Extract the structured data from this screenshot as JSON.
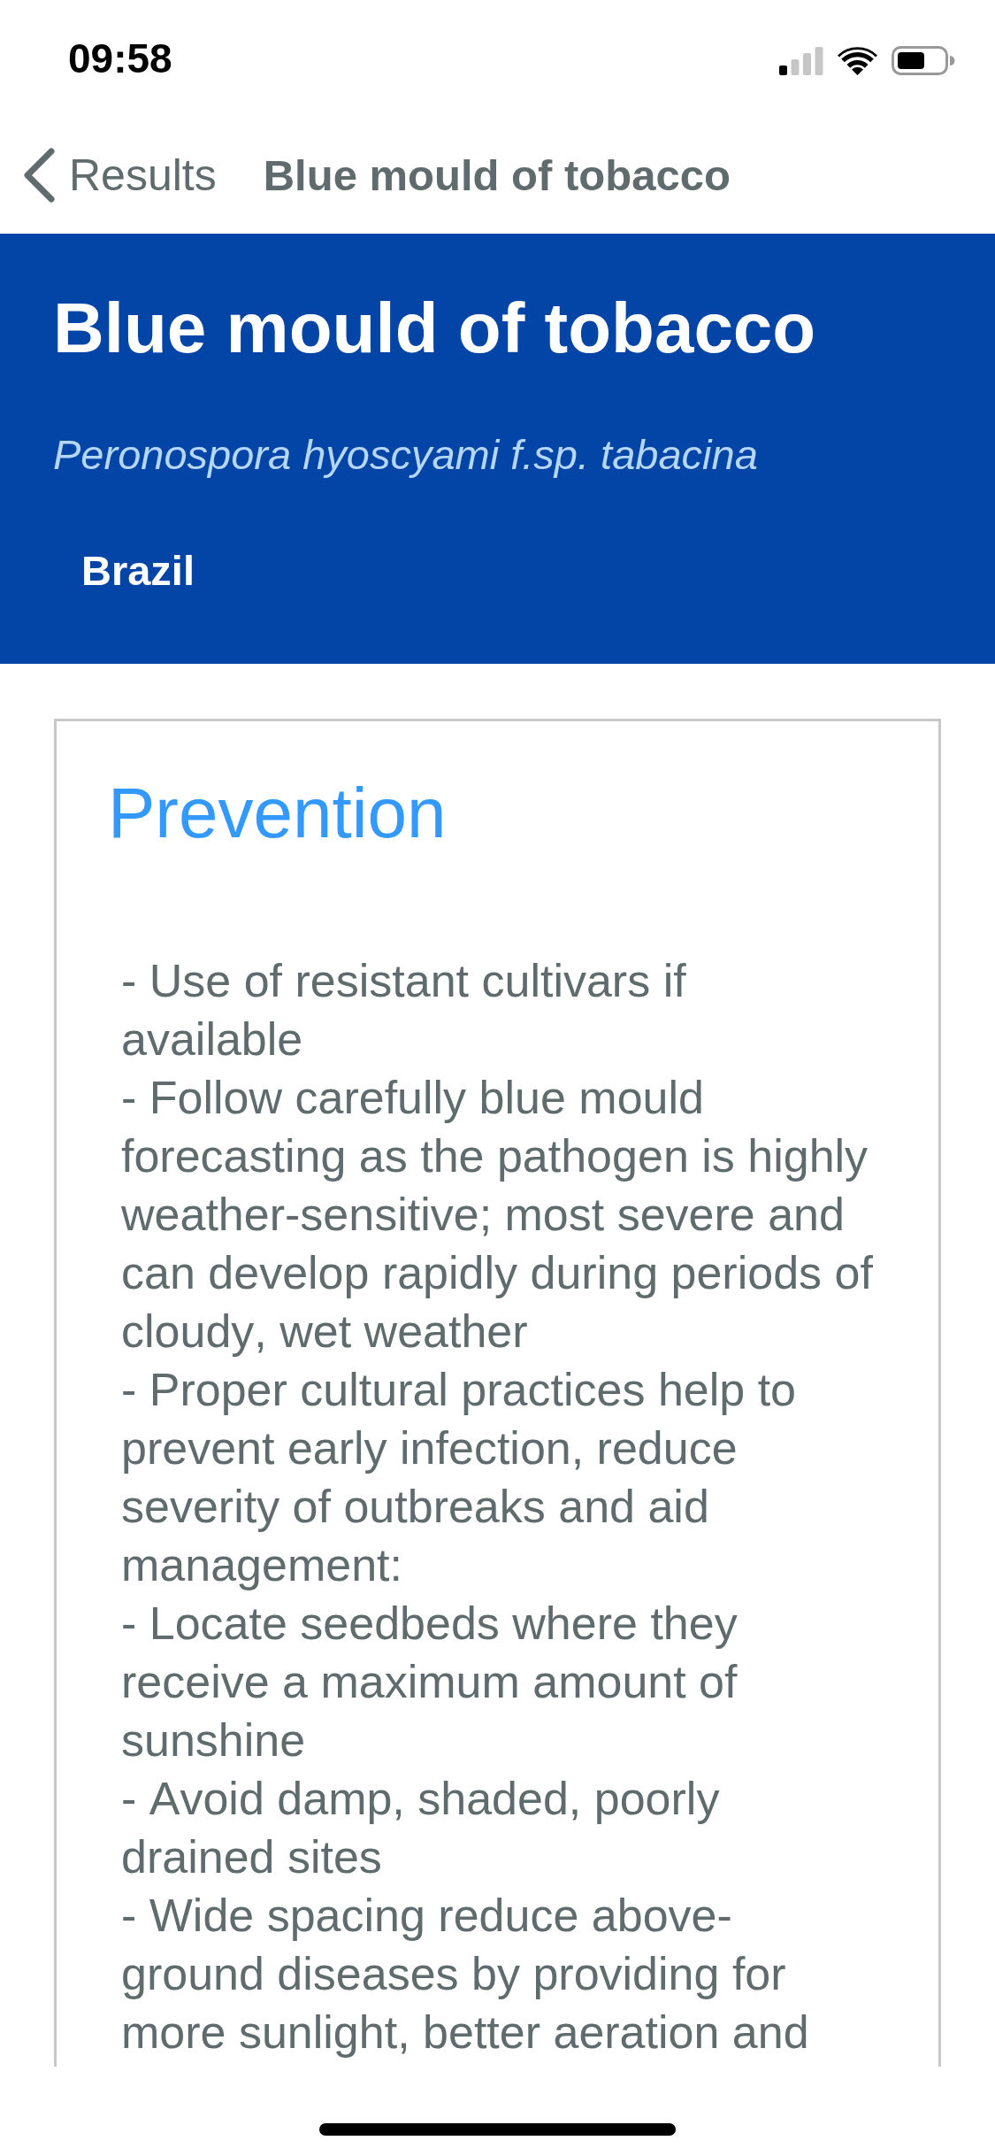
{
  "status_bar": {
    "time": "09:58"
  },
  "nav_bar": {
    "back_label": "Results",
    "title": "Blue mould of tobacco"
  },
  "header": {
    "title": "Blue mould of tobacco",
    "scientific_name": "Peronospora hyoscyami f.sp. tabacina",
    "country": "Brazil"
  },
  "section": {
    "title": "Prevention",
    "items": [
      "- Use of resistant cultivars if available",
      "- Follow carefully blue mould forecasting as the pathogen is highly weather-sensitive; most severe and can develop rapidly during periods of cloudy, wet weather",
      "- Proper cultural practices help to prevent early infection, reduce severity of outbreaks and aid management:",
      "- Locate seedbeds where they receive a maximum amount of sunshine",
      "- Avoid damp, shaded, poorly drained sites",
      "- Wide spacing reduce above-ground diseases by providing for more sunlight, better aeration and"
    ]
  }
}
